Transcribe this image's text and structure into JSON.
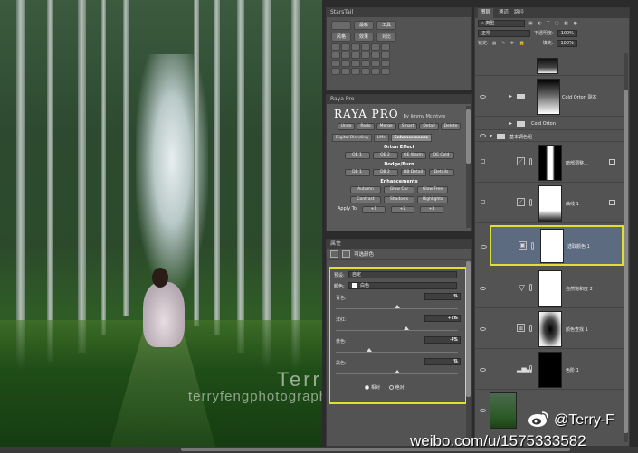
{
  "photo": {
    "watermark_name": "Terry  F",
    "watermark_url": "terryfengphotography.lofter.com"
  },
  "starstail": {
    "title": "StarsTail",
    "buttons": [
      "",
      "最新",
      "工具",
      "风格",
      "效果",
      "对比"
    ]
  },
  "raya": {
    "panel_title": "Raya Pro",
    "logo": "RAYA PRO",
    "author": "By Jimmy McIntyre",
    "top_buttons": [
      "Undo",
      "Redo",
      "Merge",
      "Smart",
      "Detail",
      "Delete"
    ],
    "tabs": [
      "Digital Blending",
      "LMs",
      "Enhancements"
    ],
    "active_tab": "Enhancements",
    "orton_title": "Orton Effect",
    "orton_buttons": [
      "OE 1",
      "OE 2",
      "OE Warm",
      "OE Cold"
    ],
    "dodge_title": "Dodge/Burn",
    "dodge_buttons": [
      "DB 1",
      "DB 2",
      "DB Detail",
      "Details"
    ],
    "enh_title": "Enhancements",
    "enh_buttons": [
      "Autumn",
      "Glow Cur",
      "Glow Free",
      "Contrast",
      "Shadows",
      "Highlights"
    ],
    "apply_to": "Apply To",
    "apply_buttons": [
      "+1",
      "+2",
      "+3"
    ]
  },
  "properties": {
    "title": "属性",
    "layer_type": "可选颜色",
    "preset_label": "预设:",
    "preset_value": "自定",
    "colors_label": "颜色:",
    "colors_value": "白色",
    "sliders": [
      {
        "label": "青色:",
        "value": "0",
        "unit": "%",
        "level": 0
      },
      {
        "label": "洋红:",
        "value": "+16",
        "unit": "%",
        "level": 16
      },
      {
        "label": "黄色:",
        "value": "-45",
        "unit": "%",
        "level": -45
      },
      {
        "label": "黑色:",
        "value": "0",
        "unit": "%",
        "level": 0
      }
    ],
    "method_relative": "相对",
    "method_absolute": "绝对",
    "method_selected": "相对"
  },
  "layers": {
    "tabs": [
      "图层",
      "通道",
      "路径"
    ],
    "kind_filter": "类型",
    "blend_mode": "正常",
    "opacity_label": "不透明度:",
    "opacity_value": "100%",
    "lock_label": "锁定:",
    "fill_label": "填充:",
    "fill_value": "100%",
    "items": [
      {
        "name": "Cold Orton 副本",
        "kind": "group"
      },
      {
        "name": "Cold Orton",
        "kind": "group"
      },
      {
        "name": "基本调色组",
        "kind": "group"
      },
      {
        "name": "暗部调整...",
        "kind": "curves"
      },
      {
        "name": "曲线 1",
        "kind": "curves"
      },
      {
        "name": "选取颜色 1",
        "kind": "selective-color"
      },
      {
        "name": "自然饱和度 2",
        "kind": "vibrance"
      },
      {
        "name": "颜色查找 1",
        "kind": "lookup"
      },
      {
        "name": "色阶 1",
        "kind": "levels"
      }
    ]
  },
  "weibo": {
    "handle": "@Terry-F",
    "url": "weibo.com/u/1575333582"
  }
}
